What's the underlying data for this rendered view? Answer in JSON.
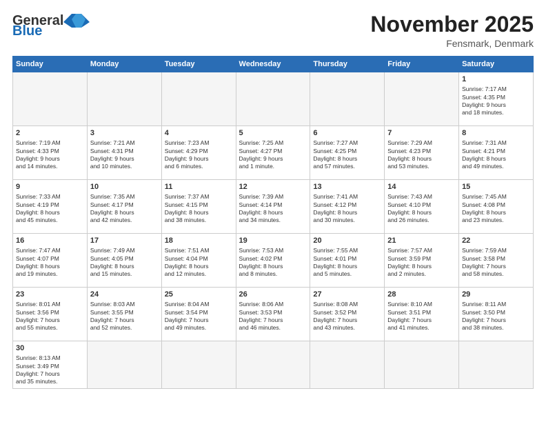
{
  "header": {
    "logo_general": "General",
    "logo_blue": "Blue",
    "month_title": "November 2025",
    "location": "Fensmark, Denmark"
  },
  "days_of_week": [
    "Sunday",
    "Monday",
    "Tuesday",
    "Wednesday",
    "Thursday",
    "Friday",
    "Saturday"
  ],
  "weeks": [
    [
      {
        "num": "",
        "info": ""
      },
      {
        "num": "",
        "info": ""
      },
      {
        "num": "",
        "info": ""
      },
      {
        "num": "",
        "info": ""
      },
      {
        "num": "",
        "info": ""
      },
      {
        "num": "",
        "info": ""
      },
      {
        "num": "1",
        "info": "Sunrise: 7:17 AM\nSunset: 4:35 PM\nDaylight: 9 hours\nand 18 minutes."
      }
    ],
    [
      {
        "num": "2",
        "info": "Sunrise: 7:19 AM\nSunset: 4:33 PM\nDaylight: 9 hours\nand 14 minutes."
      },
      {
        "num": "3",
        "info": "Sunrise: 7:21 AM\nSunset: 4:31 PM\nDaylight: 9 hours\nand 10 minutes."
      },
      {
        "num": "4",
        "info": "Sunrise: 7:23 AM\nSunset: 4:29 PM\nDaylight: 9 hours\nand 6 minutes."
      },
      {
        "num": "5",
        "info": "Sunrise: 7:25 AM\nSunset: 4:27 PM\nDaylight: 9 hours\nand 1 minute."
      },
      {
        "num": "6",
        "info": "Sunrise: 7:27 AM\nSunset: 4:25 PM\nDaylight: 8 hours\nand 57 minutes."
      },
      {
        "num": "7",
        "info": "Sunrise: 7:29 AM\nSunset: 4:23 PM\nDaylight: 8 hours\nand 53 minutes."
      },
      {
        "num": "8",
        "info": "Sunrise: 7:31 AM\nSunset: 4:21 PM\nDaylight: 8 hours\nand 49 minutes."
      }
    ],
    [
      {
        "num": "9",
        "info": "Sunrise: 7:33 AM\nSunset: 4:19 PM\nDaylight: 8 hours\nand 45 minutes."
      },
      {
        "num": "10",
        "info": "Sunrise: 7:35 AM\nSunset: 4:17 PM\nDaylight: 8 hours\nand 42 minutes."
      },
      {
        "num": "11",
        "info": "Sunrise: 7:37 AM\nSunset: 4:15 PM\nDaylight: 8 hours\nand 38 minutes."
      },
      {
        "num": "12",
        "info": "Sunrise: 7:39 AM\nSunset: 4:14 PM\nDaylight: 8 hours\nand 34 minutes."
      },
      {
        "num": "13",
        "info": "Sunrise: 7:41 AM\nSunset: 4:12 PM\nDaylight: 8 hours\nand 30 minutes."
      },
      {
        "num": "14",
        "info": "Sunrise: 7:43 AM\nSunset: 4:10 PM\nDaylight: 8 hours\nand 26 minutes."
      },
      {
        "num": "15",
        "info": "Sunrise: 7:45 AM\nSunset: 4:08 PM\nDaylight: 8 hours\nand 23 minutes."
      }
    ],
    [
      {
        "num": "16",
        "info": "Sunrise: 7:47 AM\nSunset: 4:07 PM\nDaylight: 8 hours\nand 19 minutes."
      },
      {
        "num": "17",
        "info": "Sunrise: 7:49 AM\nSunset: 4:05 PM\nDaylight: 8 hours\nand 15 minutes."
      },
      {
        "num": "18",
        "info": "Sunrise: 7:51 AM\nSunset: 4:04 PM\nDaylight: 8 hours\nand 12 minutes."
      },
      {
        "num": "19",
        "info": "Sunrise: 7:53 AM\nSunset: 4:02 PM\nDaylight: 8 hours\nand 8 minutes."
      },
      {
        "num": "20",
        "info": "Sunrise: 7:55 AM\nSunset: 4:01 PM\nDaylight: 8 hours\nand 5 minutes."
      },
      {
        "num": "21",
        "info": "Sunrise: 7:57 AM\nSunset: 3:59 PM\nDaylight: 8 hours\nand 2 minutes."
      },
      {
        "num": "22",
        "info": "Sunrise: 7:59 AM\nSunset: 3:58 PM\nDaylight: 7 hours\nand 58 minutes."
      }
    ],
    [
      {
        "num": "23",
        "info": "Sunrise: 8:01 AM\nSunset: 3:56 PM\nDaylight: 7 hours\nand 55 minutes."
      },
      {
        "num": "24",
        "info": "Sunrise: 8:03 AM\nSunset: 3:55 PM\nDaylight: 7 hours\nand 52 minutes."
      },
      {
        "num": "25",
        "info": "Sunrise: 8:04 AM\nSunset: 3:54 PM\nDaylight: 7 hours\nand 49 minutes."
      },
      {
        "num": "26",
        "info": "Sunrise: 8:06 AM\nSunset: 3:53 PM\nDaylight: 7 hours\nand 46 minutes."
      },
      {
        "num": "27",
        "info": "Sunrise: 8:08 AM\nSunset: 3:52 PM\nDaylight: 7 hours\nand 43 minutes."
      },
      {
        "num": "28",
        "info": "Sunrise: 8:10 AM\nSunset: 3:51 PM\nDaylight: 7 hours\nand 41 minutes."
      },
      {
        "num": "29",
        "info": "Sunrise: 8:11 AM\nSunset: 3:50 PM\nDaylight: 7 hours\nand 38 minutes."
      }
    ],
    [
      {
        "num": "30",
        "info": "Sunrise: 8:13 AM\nSunset: 3:49 PM\nDaylight: 7 hours\nand 35 minutes."
      },
      {
        "num": "",
        "info": ""
      },
      {
        "num": "",
        "info": ""
      },
      {
        "num": "",
        "info": ""
      },
      {
        "num": "",
        "info": ""
      },
      {
        "num": "",
        "info": ""
      },
      {
        "num": "",
        "info": ""
      }
    ]
  ]
}
